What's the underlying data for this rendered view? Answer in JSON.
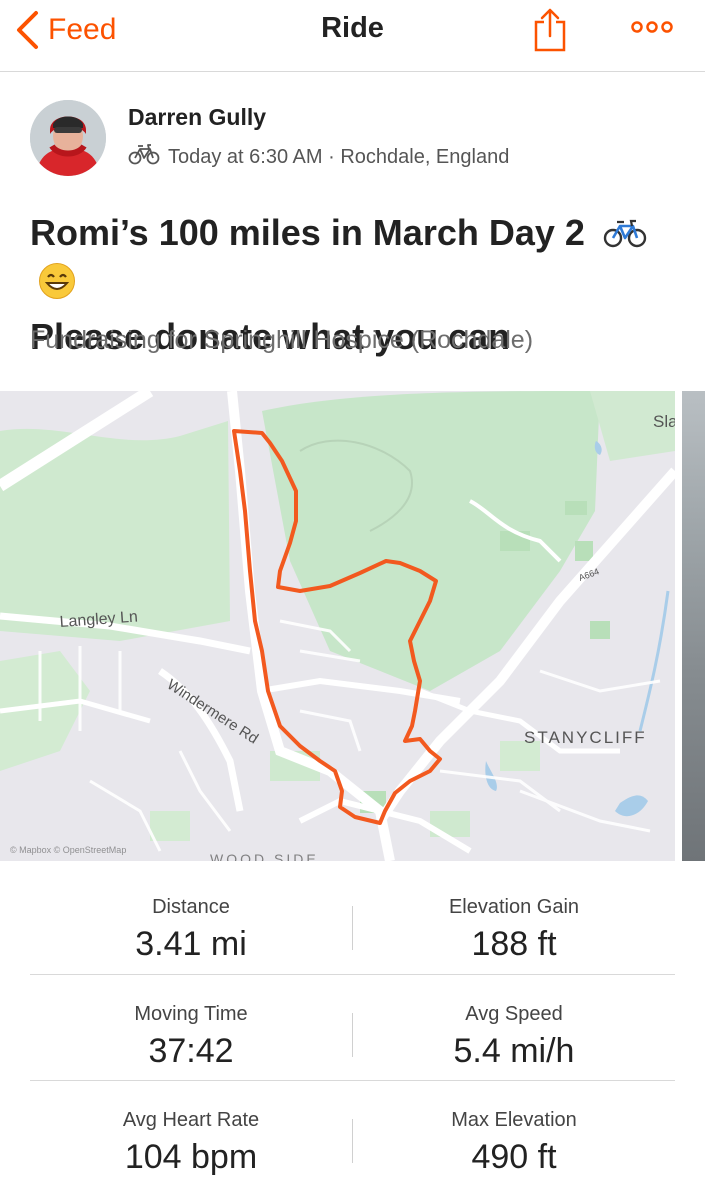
{
  "nav": {
    "back_label": "Feed",
    "title": "Ride",
    "share_icon": "share-icon",
    "more_icon": "more-icon"
  },
  "colors": {
    "accent": "#fc5200",
    "route": "#f2591f",
    "map_park": "#c9e8cc",
    "map_land": "#e8e7ec",
    "divider": "#d9d9d9"
  },
  "athlete": {
    "name": "Darren Gully",
    "activity_icon": "bike-icon",
    "time_location": "Today at 6:30 AM · Rochdale, England"
  },
  "activity": {
    "title_line1": "Romi’s 100 miles in March Day 2",
    "title_line2": "Please donate what you can",
    "title_icons": [
      "bike-emoji",
      "grinning-face-emoji"
    ],
    "description": "Fundraising for Springhill Hospice (Rochdale)"
  },
  "map": {
    "labels": {
      "langley": "Langley Ln",
      "windermere": "Windermere Rd",
      "stanycliff": "STANYCLIFF",
      "sla": "Sla",
      "a664": "A664",
      "attribution": "© Mapbox © OpenStreetMap",
      "woodside": "WOOD SIDE"
    }
  },
  "stats": [
    {
      "label": "Distance",
      "value": "3.41 mi"
    },
    {
      "label": "Elevation Gain",
      "value": "188 ft"
    },
    {
      "label": "Moving Time",
      "value": "37:42"
    },
    {
      "label": "Avg Speed",
      "value": "5.4 mi/h"
    },
    {
      "label": "Avg Heart Rate",
      "value": "104 bpm"
    },
    {
      "label": "Max Elevation",
      "value": "490 ft"
    }
  ]
}
